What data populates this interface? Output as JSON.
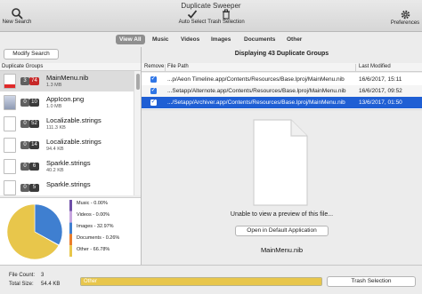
{
  "window": {
    "title": "Duplicate Sweeper"
  },
  "toolbar": {
    "new_search": "New Search",
    "auto_select": "Auto Select",
    "trash_selection": "Trash Selection",
    "preferences": "Preferences"
  },
  "filters": [
    "View All",
    "Music",
    "Videos",
    "Images",
    "Documents",
    "Other"
  ],
  "left": {
    "modify_search": "Modify Search",
    "header": "Duplicate Groups",
    "groups": [
      {
        "count": "3",
        "number": "74",
        "name": "MainMenu.nib",
        "size": "1.3 MB",
        "icon": "nib-file-icon"
      },
      {
        "count": "0",
        "number": "10",
        "name": "AppIcon.png",
        "size": "1.0 MB",
        "icon": "png-image-icon"
      },
      {
        "count": "0",
        "number": "52",
        "name": "Localizable.strings",
        "size": "111.3 KB",
        "icon": "strings-file-icon"
      },
      {
        "count": "0",
        "number": "14",
        "name": "Localizable.strings",
        "size": "94.4 KB",
        "icon": "strings-file-icon"
      },
      {
        "count": "0",
        "number": "6",
        "name": "Sparkle.strings",
        "size": "40.2 KB",
        "icon": "strings-file-icon"
      },
      {
        "count": "0",
        "number": "5",
        "name": "Sparkle.strings",
        "size": "",
        "icon": "strings-file-icon"
      }
    ]
  },
  "stats": {
    "legend": [
      {
        "label": "Music - 0.00%",
        "color": "#6f4fa8",
        "value": 0.0
      },
      {
        "label": "Videos - 0.00%",
        "color": "#c7a6df",
        "value": 0.0
      },
      {
        "label": "Images - 32.97%",
        "color": "#3f7fd0",
        "value": 32.97
      },
      {
        "label": "Documents - 0.26%",
        "color": "#ea7d2b",
        "value": 0.26
      },
      {
        "label": "Other - 66.78%",
        "color": "#e8c64b",
        "value": 66.78
      }
    ]
  },
  "right": {
    "title": "Displaying 43 Duplicate Groups",
    "columns": {
      "remove": "Remove",
      "path": "File Path",
      "modified": "Last Modified"
    },
    "rows": [
      {
        "path": "...p/Aeon Timeline.app/Contents/Resources/Base.lproj/MainMenu.nib",
        "date": "16/6/2017, 15:11",
        "checked": true,
        "selected": false
      },
      {
        "path": "...Setapp/Alternote.app/Contents/Resources/Base.lproj/MainMenu.nib",
        "date": "16/6/2017, 09:52",
        "checked": true,
        "selected": false
      },
      {
        "path": ".../Setapp/Archiver.app/Contents/Resources/Base.lproj/MainMenu.nib",
        "date": "13/6/2017, 01:50",
        "checked": true,
        "selected": true
      }
    ],
    "preview_message": "Unable to view a preview of this file...",
    "open_button": "Open in Default Application",
    "preview_name": "MainMenu.nib"
  },
  "footer": {
    "file_count_label": "File Count:",
    "file_count": "3",
    "total_size_label": "Total Size:",
    "total_size": "54.4 KB",
    "usage_label": "Other",
    "usage_color": "#e8c64b",
    "usage_fraction": 1.0,
    "trash_button": "Trash Selection"
  },
  "colors": {
    "selection": "#1f5fd4",
    "checkbox": "#2f76e6",
    "badge_alert": "#c62828"
  }
}
